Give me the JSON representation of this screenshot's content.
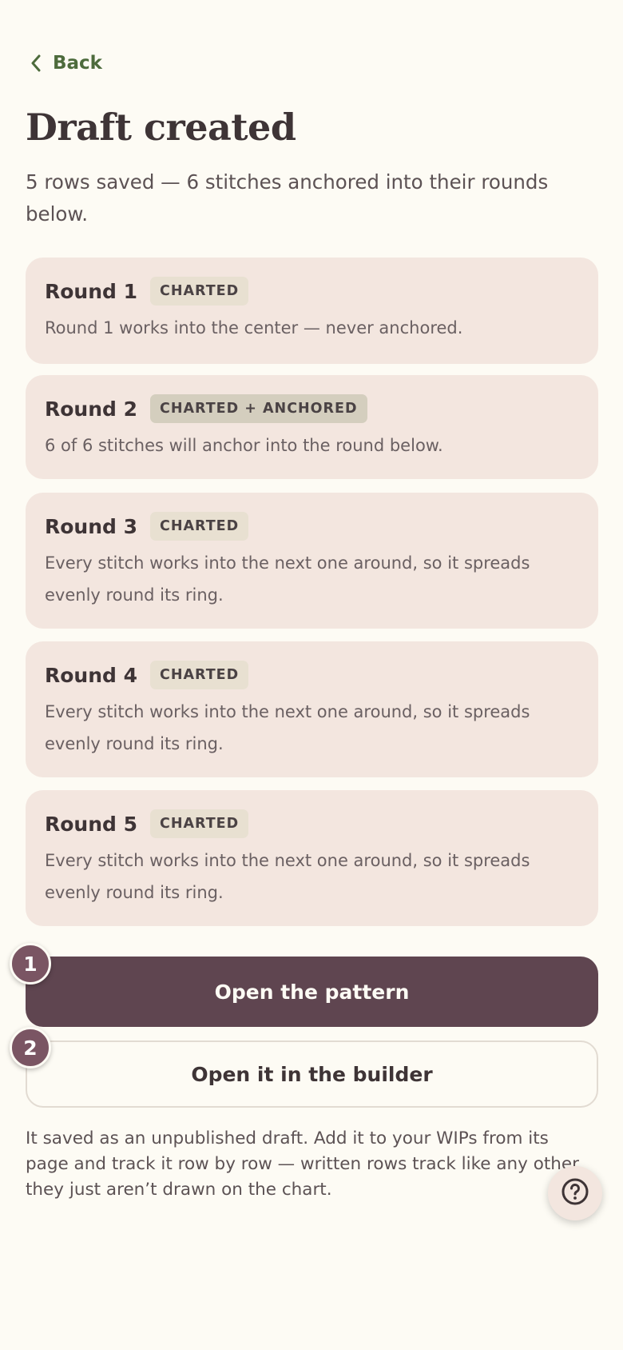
{
  "nav": {
    "back_label": "Back"
  },
  "header": {
    "title": "Draft created",
    "subtitle": "5 rows saved — 6 stitches anchored into their rounds below."
  },
  "rounds": [
    {
      "title": "Round 1",
      "badge": "CHARTED",
      "description": "Round 1 works into the center — never anchored."
    },
    {
      "title": "Round 2",
      "badge": "CHARTED + ANCHORED",
      "description": "6 of 6 stitches will anchor into the round below."
    },
    {
      "title": "Round 3",
      "badge": "CHARTED",
      "description": "Every stitch works into the next one around, so it spreads evenly round its ring."
    },
    {
      "title": "Round 4",
      "badge": "CHARTED",
      "description": "Every stitch works into the next one around, so it spreads evenly round its ring."
    },
    {
      "title": "Round 5",
      "badge": "CHARTED",
      "description": "Every stitch works into the next one around, so it spreads evenly round its ring."
    }
  ],
  "actions": {
    "primary_label": "Open the pattern",
    "secondary_label": "Open it in the builder",
    "step_1": "1",
    "step_2": "2"
  },
  "footer_note": "It saved as an unpublished draft. Add it to your WIPs from its page and track it row by row — written rows track like any other they just aren’t drawn on the chart.",
  "icons": {
    "back": "chevron-left-icon",
    "help": "question-circle-icon"
  },
  "colors": {
    "accent_green": "#4d6b3c",
    "primary_button": "#5f4550",
    "card_bg": "#f3e6df",
    "step_badge": "#7a5563"
  }
}
